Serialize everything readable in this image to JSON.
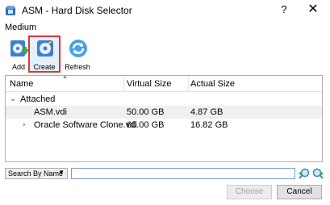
{
  "window": {
    "title": "ASM - Hard Disk Selector",
    "help_glyph": "?",
    "close_glyph": "✕",
    "app_icon": "virtualbox-icon"
  },
  "section_label": "Medium",
  "toolbar": {
    "add_label": "Add",
    "create_label": "Create",
    "refresh_label": "Refresh",
    "highlight_color": "#d9383a"
  },
  "table": {
    "columns": [
      "Name",
      "Virtual Size",
      "Actual Size"
    ],
    "group": {
      "label": "Attached",
      "expanded": true
    },
    "rows": [
      {
        "name": "ASM.vdi",
        "virtual": "50.00 GB",
        "actual": "4.87 GB",
        "selected": true
      },
      {
        "name": "Oracle Software Clone.vdi",
        "virtual": "60.00 GB",
        "actual": "16.82 GB",
        "selected": false,
        "expandable": true
      }
    ]
  },
  "search": {
    "mode": "Search By Name",
    "value": ""
  },
  "buttons": {
    "choose": "Choose",
    "cancel": "Cancel"
  }
}
